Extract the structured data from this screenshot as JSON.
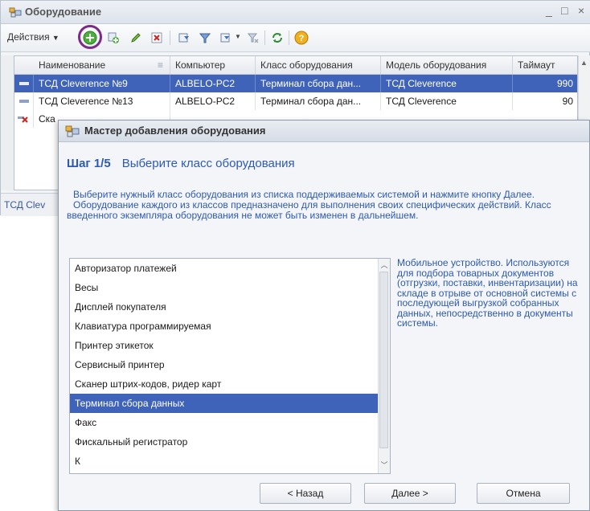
{
  "main_window": {
    "title": "Оборудование",
    "controls": {
      "minimize": "_",
      "maximize": "□",
      "close": "×"
    },
    "toolbar": {
      "actions_label": "Действия",
      "icons": [
        "add-circle-icon",
        "copy-add-icon",
        "edit-pencil-icon",
        "delete-x-icon",
        "filter-icon",
        "filter-list-icon",
        "filter-dropdown-icon",
        "filter-clear-icon",
        "refresh-icon",
        "help-icon"
      ],
      "help_glyph": "?"
    },
    "grid": {
      "columns": [
        "Наименование",
        "Компьютер",
        "Класс оборудования",
        "Модель оборудования",
        "Таймаут"
      ],
      "rows": [
        {
          "name": "ТСД Cleverence №9",
          "computer": "ALBELO-PC2",
          "class": "Терминал сбора дан...",
          "model": "ТСД Cleverence",
          "timeout": "990"
        },
        {
          "name": "ТСД Cleverence №13",
          "computer": "ALBELO-PC2",
          "class": "Терминал сбора дан...",
          "model": "ТСД Cleverence",
          "timeout": "90"
        },
        {
          "name": "Ска",
          "computer": "",
          "class": "",
          "model": "",
          "timeout": ""
        }
      ]
    },
    "status_text": "ТСД Clev"
  },
  "dialog": {
    "title": "Мастер добавления оборудования",
    "step_label": "Шаг 1/5",
    "step_title": "Выберите класс оборудования",
    "description_1": "Выберите нужный класс оборудования из списка поддерживаемых системой и нажмите кнопку Далее.",
    "description_2": "Оборудование каждого из классов предназначено для выполнения своих специфических действий. Класс введенного экземпляра оборудования не может быть изменен в дальнейшем.",
    "classes": [
      "Авторизатор платежей",
      "Весы",
      "Дисплей покупателя",
      "Клавиатура программируемая",
      "Принтер этикеток",
      "Сервисный принтер",
      "Сканер штрих-кодов, ридер карт",
      "Терминал сбора данных",
      "Факс",
      "Фискальный регистратор",
      "К"
    ],
    "selected_index": 7,
    "info_text": "Мобильное устройство. Используются для подбора товарных документов (отгрузки, поставки, инвентаризации) на складе в отрыве от основной системы с последующей выгрузкой собранных данных, непосредственно в документы системы.",
    "buttons": {
      "back": "< Назад",
      "next": "Далее >",
      "cancel": "Отмена"
    }
  },
  "colors": {
    "selection": "#3f63b8",
    "accent_text": "#2e5ab0",
    "highlight_ring": "#7b2a8c"
  }
}
